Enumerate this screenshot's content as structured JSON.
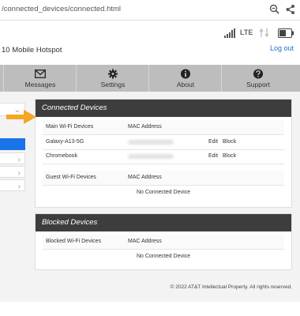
{
  "browser": {
    "url": "/connected_devices/connected.html",
    "zoom_icon": "zoom-out-icon",
    "share_icon": "share-icon"
  },
  "header": {
    "hotspot_name": "10 Mobile Hotspot",
    "network_type": "LTE",
    "logout_label": "Log out",
    "icons": [
      "signal-bars-icon",
      "data-arrows-icon",
      "battery-icon"
    ]
  },
  "nav": {
    "items": [
      {
        "label": "Messages",
        "icon": "envelope-icon"
      },
      {
        "label": "Settings",
        "icon": "gear-icon"
      },
      {
        "label": "About",
        "icon": "info-icon"
      },
      {
        "label": "Support",
        "icon": "question-icon"
      }
    ]
  },
  "connected_panel": {
    "title": "Connected Devices",
    "main_wifi": {
      "col_device": "Main Wi-Fi Devices",
      "col_mac": "MAC Address",
      "rows": [
        {
          "device": "Galaxy-A13-5G",
          "edit": "Edit",
          "block": "Block"
        },
        {
          "device": "Chromebook",
          "edit": "Edit",
          "block": "Block"
        }
      ]
    },
    "guest_wifi": {
      "col_device": "Guest Wi-Fi Devices",
      "col_mac": "MAC Address",
      "empty_text": "No Connected Device"
    }
  },
  "blocked_panel": {
    "title": "Blocked Devices",
    "col_device": "Blocked Wi-Fi Devices",
    "col_mac": "MAC Address",
    "empty_text": "No Connected Device"
  },
  "footer": {
    "copyright": "© 2022 AT&T Intellectual Property. All rights reserved."
  },
  "colors": {
    "nav_bg": "#bdbdbd",
    "panel_title_bg": "#3d3d3d",
    "link": "#1a6fd0",
    "active_sidebar": "#1a73e8",
    "annotation_arrow": "#f5a623"
  }
}
